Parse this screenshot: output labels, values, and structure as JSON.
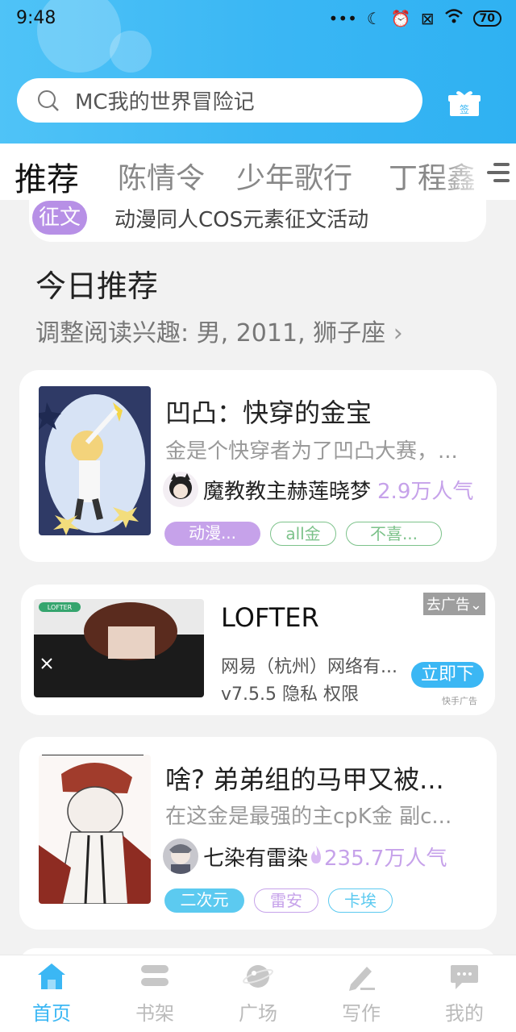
{
  "status_bar": {
    "time": "9:48",
    "battery": "70"
  },
  "search": {
    "text": "MC我的世界冒险记",
    "gift_label": "签"
  },
  "tabs": [
    "推荐",
    "陈情令",
    "少年歌行",
    "丁程鑫"
  ],
  "banner": {
    "tag": "征文",
    "text": "动漫同人COS元素征文活动"
  },
  "section": {
    "title": "今日推荐",
    "subtitle": "调整阅读兴趣: 男, 2011, 狮子座"
  },
  "books": [
    {
      "title": "凹凸：快穿的金宝",
      "desc": "金是个快穿者为了凹凸大赛，...",
      "author": "魔教教主赫莲晓梦",
      "popularity": "2.9万人气",
      "tags": [
        {
          "label": "动漫...",
          "style": "filled",
          "color": "#c6a2ea"
        },
        {
          "label": "all金",
          "style": "outline",
          "color": "#7cc28a"
        },
        {
          "label": "不喜...",
          "style": "outline",
          "color": "#7cc28a"
        }
      ]
    },
    {
      "title": "啥? 弟弟组的马甲又被...",
      "desc": "在这金是最强的主cpK金  副c...",
      "author": "七染有雷染",
      "popularity": "235.7万人气",
      "tags": [
        {
          "label": "二次元",
          "style": "filled",
          "color": "#5ccaf0"
        },
        {
          "label": "雷安",
          "style": "outline",
          "color": "#c6a2ea"
        },
        {
          "label": "卡埃",
          "style": "outline",
          "color": "#5ccaf0"
        }
      ]
    }
  ],
  "ad": {
    "title": "LOFTER",
    "company": "网易（杭州）网络有...",
    "version": "v7.5.5  隐私  权限",
    "close_label": "去广告",
    "button_label": "立即下",
    "source": "快手广告",
    "logo_text": "LOFTER"
  },
  "bottom_nav": [
    "首页",
    "书架",
    "广场",
    "写作",
    "我的"
  ],
  "colors": {
    "accent": "#3bb7f4",
    "purple": "#b790e6"
  }
}
